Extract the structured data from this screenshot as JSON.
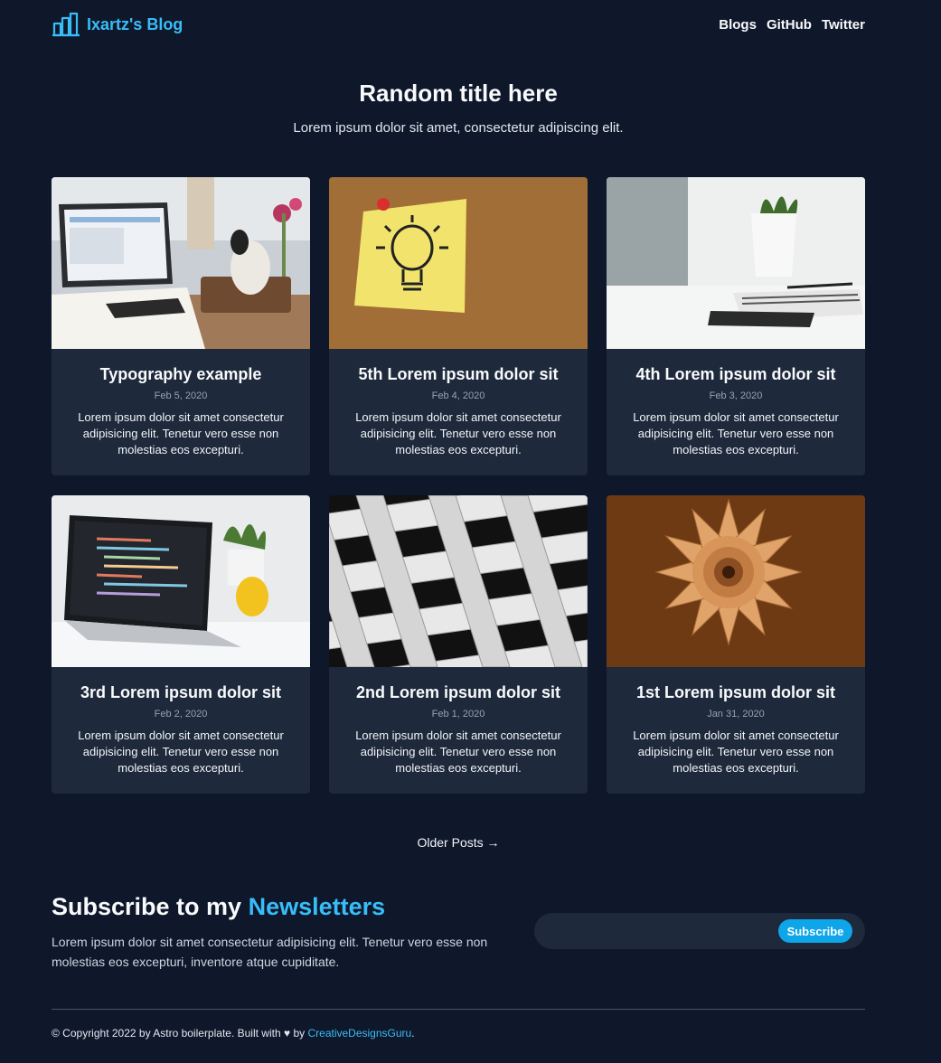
{
  "header": {
    "logo_icon": "bar-chart-icon",
    "brand": "Ixartz's Blog",
    "nav": [
      {
        "label": "Blogs"
      },
      {
        "label": "GitHub"
      },
      {
        "label": "Twitter"
      }
    ]
  },
  "hero": {
    "title": "Random title here",
    "subtitle": "Lorem ipsum dolor sit amet, consectetur adipiscing elit."
  },
  "posts": [
    {
      "title": "Typography example",
      "date": "Feb 5, 2020",
      "excerpt": "Lorem ipsum dolor sit amet consectetur adipisicing elit. Tenetur vero esse non molestias eos excepturi.",
      "image": "laptop-desk-photo"
    },
    {
      "title": "5th Lorem ipsum dolor sit",
      "date": "Feb 4, 2020",
      "excerpt": "Lorem ipsum dolor sit amet consectetur adipisicing elit. Tenetur vero esse non molestias eos excepturi.",
      "image": "lightbulb-sticky-note-photo"
    },
    {
      "title": "4th Lorem ipsum dolor sit",
      "date": "Feb 3, 2020",
      "excerpt": "Lorem ipsum dolor sit amet consectetur adipisicing elit. Tenetur vero esse non molestias eos excepturi.",
      "image": "white-desk-plant-photo"
    },
    {
      "title": "3rd Lorem ipsum dolor sit",
      "date": "Feb 2, 2020",
      "excerpt": "Lorem ipsum dolor sit amet consectetur adipisicing elit. Tenetur vero esse non molestias eos excepturi.",
      "image": "code-laptop-photo"
    },
    {
      "title": "2nd Lorem ipsum dolor sit",
      "date": "Feb 1, 2020",
      "excerpt": "Lorem ipsum dolor sit amet consectetur adipisicing elit. Tenetur vero esse non molestias eos excepturi.",
      "image": "building-facade-photo"
    },
    {
      "title": "1st Lorem ipsum dolor sit",
      "date": "Jan 31, 2020",
      "excerpt": "Lorem ipsum dolor sit amet consectetur adipisicing elit. Tenetur vero esse non molestias eos excepturi.",
      "image": "spiral-sculpture-photo"
    }
  ],
  "older_posts": {
    "label": "Older Posts →"
  },
  "newsletter": {
    "title_prefix": "Subscribe to my",
    "title_accent": "Newsletters",
    "description": "Lorem ipsum dolor sit amet consectetur adipisicing elit. Tenetur vero esse non molestias eos excepturi, inventore atque cupiditate.",
    "input_value": "",
    "button_label": "Subscribe"
  },
  "footer": {
    "text_before": "© Copyright 2022 by Astro boilerplate. Built with",
    "heart_icon": "heart-icon",
    "text_by": "by",
    "link_label": "CreativeDesignsGuru",
    "text_after": "."
  },
  "colors": {
    "background": "#0f172a",
    "card": "#1e293b",
    "accent": "#38bdf8",
    "button": "#0ea5e9"
  }
}
